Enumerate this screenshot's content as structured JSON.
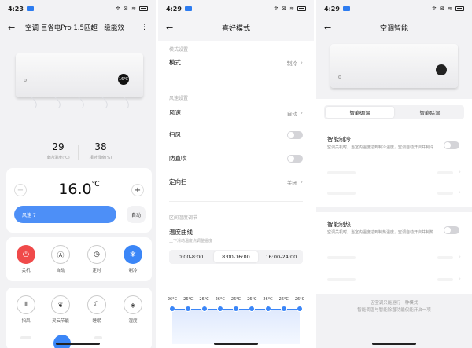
{
  "p1": {
    "status_time": "4:23",
    "title": "空调 巨省电Pro 1.5匹超一级能效",
    "display_temp": "16℃",
    "indoor_temp": "29",
    "indoor_temp_label": "室内温度(℃)",
    "humidity": "38",
    "humidity_label": "相对湿度(%)",
    "set_temp": "16.0",
    "set_temp_unit": "℃",
    "minus": "−",
    "plus": "+",
    "fan_speed_label": "风速 7",
    "auto_label": "自动",
    "controls": [
      {
        "label": "关机",
        "icon": "power-icon"
      },
      {
        "label": "自动",
        "icon": "auto-mode-icon"
      },
      {
        "label": "定时",
        "icon": "timer-icon"
      },
      {
        "label": "制冷",
        "icon": "snowflake-icon"
      }
    ],
    "features": [
      {
        "label": "扫风",
        "icon": "swing-icon"
      },
      {
        "label": "灵云节能",
        "icon": "leaf-icon"
      },
      {
        "label": "睡眠",
        "icon": "moon-icon"
      },
      {
        "label": "湿度",
        "icon": "humidity-icon"
      }
    ],
    "colors": {
      "power": "#f04a4a",
      "cool": "#3b86f7",
      "accent": "#3b86f7"
    }
  },
  "p2": {
    "status_time": "4:29",
    "title": "喜好模式",
    "mode_section": "模式设置",
    "mode_label": "模式",
    "mode_value": "制冷",
    "wind_section": "风速设置",
    "wind_label": "风速",
    "wind_value": "自动",
    "swing_label": "扫风",
    "anti_blow_label": "防直吹",
    "direction_label": "定向扫",
    "direction_value": "关闭",
    "temp_section": "区间温度调节",
    "curve_title": "温度曲线",
    "curve_sub": "上下滑动温度点调整温度",
    "time_tabs": [
      "0:00-8:00",
      "8:00-16:00",
      "16:00-24:00"
    ],
    "active_tab": 1,
    "curve_temps": [
      "26°C",
      "26°C",
      "26°C",
      "26°C",
      "26°C",
      "26°C",
      "26°C",
      "26°C",
      "26°C"
    ]
  },
  "p3": {
    "status_time": "4:29",
    "title": "空调智能",
    "tabs": [
      "智能调温",
      "智能除湿"
    ],
    "smart_cool_title": "智能制冷",
    "smart_cool_desc": "空调关机时，当室内温度达到制冷温度，空调自动开启并制冷",
    "smart_heat_title": "智能制热",
    "smart_heat_desc": "空调关机时，当室内温度达到制热温度，空调自动开启并制热",
    "footer_line1": "因空调只能运行一种模式",
    "footer_line2": "智能调温与智能除湿功能仅能开启一项"
  }
}
